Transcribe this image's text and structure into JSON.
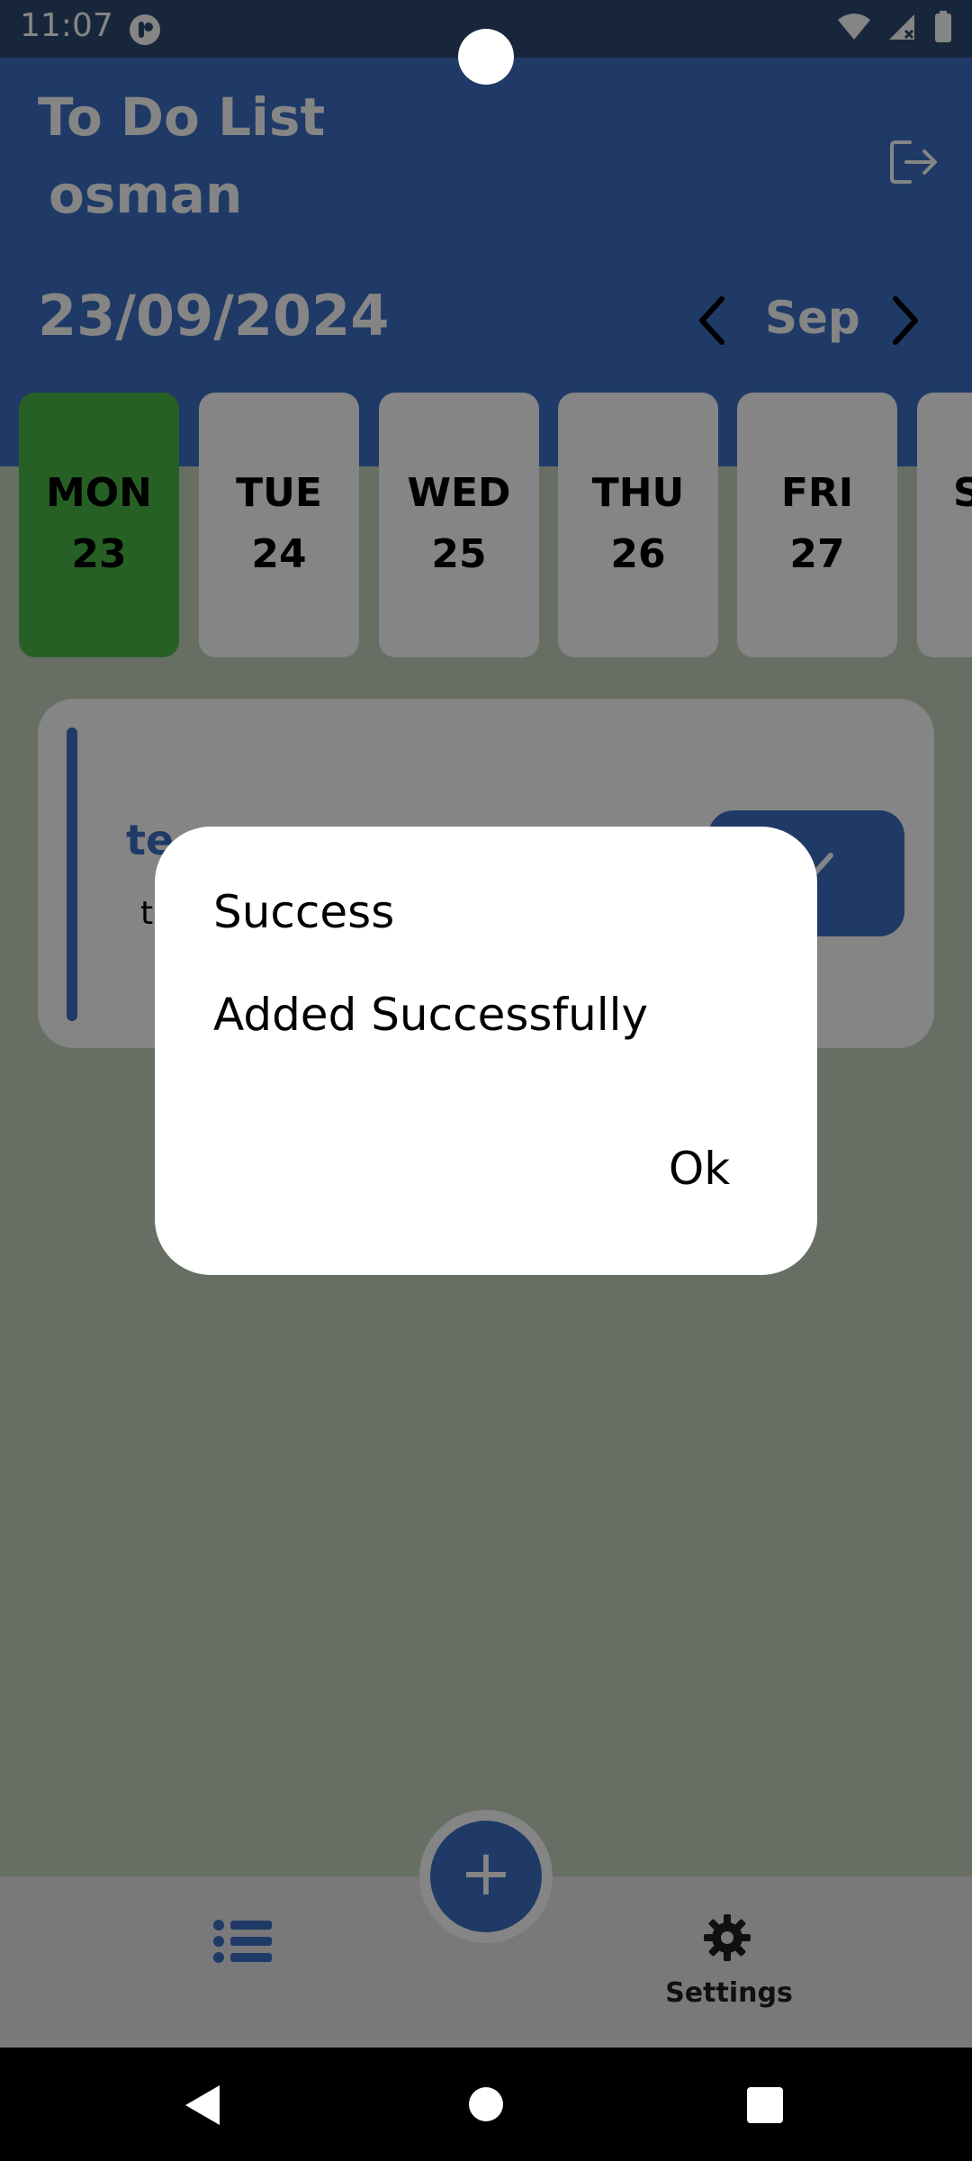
{
  "status_bar": {
    "time": "11:07"
  },
  "header": {
    "title": "To Do List",
    "user": "osman"
  },
  "date_bar": {
    "date": "23/09/2024",
    "month": "Sep"
  },
  "days": [
    {
      "name": "MON",
      "num": "23",
      "selected": true
    },
    {
      "name": "TUE",
      "num": "24",
      "selected": false
    },
    {
      "name": "WED",
      "num": "25",
      "selected": false
    },
    {
      "name": "THU",
      "num": "26",
      "selected": false
    },
    {
      "name": "FRI",
      "num": "27",
      "selected": false
    },
    {
      "name": "S",
      "num": "",
      "selected": false
    }
  ],
  "task": {
    "title": "te",
    "description": "t"
  },
  "bottom_nav": {
    "settings_label": "Settings"
  },
  "dialog": {
    "title": "Success",
    "message": "Added Successfully",
    "ok_label": "Ok"
  },
  "colors": {
    "primary": "#3D6FC4",
    "selected_day": "#4CB848",
    "status_bar": "#2C4A72"
  }
}
